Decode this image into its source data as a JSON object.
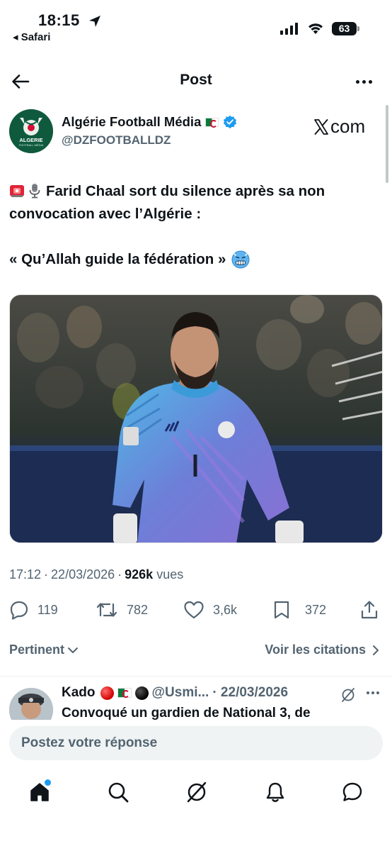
{
  "status_bar": {
    "time": "18:15",
    "back_app": "◂ Safari",
    "battery": "63"
  },
  "header": {
    "title": "Post",
    "back_icon": "arrow-left-icon",
    "more_icon": "more-dots-icon"
  },
  "post": {
    "author_name": "Algérie Football Média",
    "author_handle": "@DZFOOTBALLDZ",
    "avatar_text": "ALGERIE",
    "avatar_sub": "FOOTBALL MÉDIA",
    "source_logo": "com",
    "text_line1": "Farid Chaal sort du silence après sa non",
    "text_line2": "convocation avec l’Algérie :",
    "quote": "« Qu’Allah guide la fédération »",
    "time": "17:12",
    "date": "22/03/2026",
    "views_count": "926k",
    "views_label": "vues",
    "replies": "119",
    "reposts": "782",
    "likes": "3,6k",
    "bookmarks": "372"
  },
  "filters": {
    "sort_label": "Pertinent",
    "quotes_label": "Voir les citations"
  },
  "reply": {
    "name": "Kado",
    "handle": "@Usmi...",
    "date": "· 22/03/2026",
    "text": "Convoqué un gardien de National 3, de"
  },
  "composer": {
    "placeholder": "Postez votre réponse"
  },
  "tabbar": {
    "items": [
      "home-icon",
      "search-icon",
      "grok-icon",
      "notifications-icon",
      "messages-icon"
    ]
  },
  "colors": {
    "text": "#0f1419",
    "secondary": "#536471",
    "accent": "#1d9bf0",
    "avatar_green": "#0f5a3d"
  }
}
